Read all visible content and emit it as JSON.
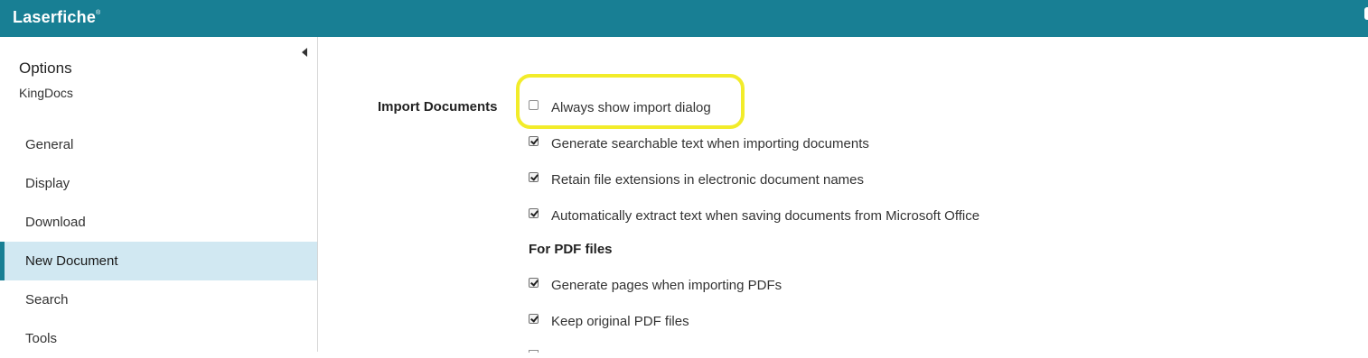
{
  "header": {
    "brand": "Laserfiche",
    "brand_mark": "®",
    "color": "#187f94"
  },
  "sidebar": {
    "title": "Options",
    "subtitle": "KingDocs",
    "collapse_icon": "caret-left-icon",
    "items": [
      {
        "label": "General",
        "active": false
      },
      {
        "label": "Display",
        "active": false
      },
      {
        "label": "Download",
        "active": false
      },
      {
        "label": "New Document",
        "active": true
      },
      {
        "label": "Search",
        "active": false
      },
      {
        "label": "Tools",
        "active": false
      }
    ],
    "active_color": "#d1e8f2"
  },
  "main": {
    "section_label": "Import Documents",
    "options": [
      {
        "label": "Always show import dialog",
        "checked": false
      },
      {
        "label": "Generate searchable text when importing documents",
        "checked": true
      },
      {
        "label": "Retain file extensions in electronic document names",
        "checked": true
      },
      {
        "label": "Automatically extract text when saving documents from Microsoft Office",
        "checked": true
      }
    ],
    "pdf_heading": "For PDF files",
    "pdf_options": [
      {
        "label": "Generate pages when importing PDFs",
        "checked": true
      },
      {
        "label": "Keep original PDF files",
        "checked": true
      }
    ],
    "highlight_color": "#f2ec2a"
  }
}
